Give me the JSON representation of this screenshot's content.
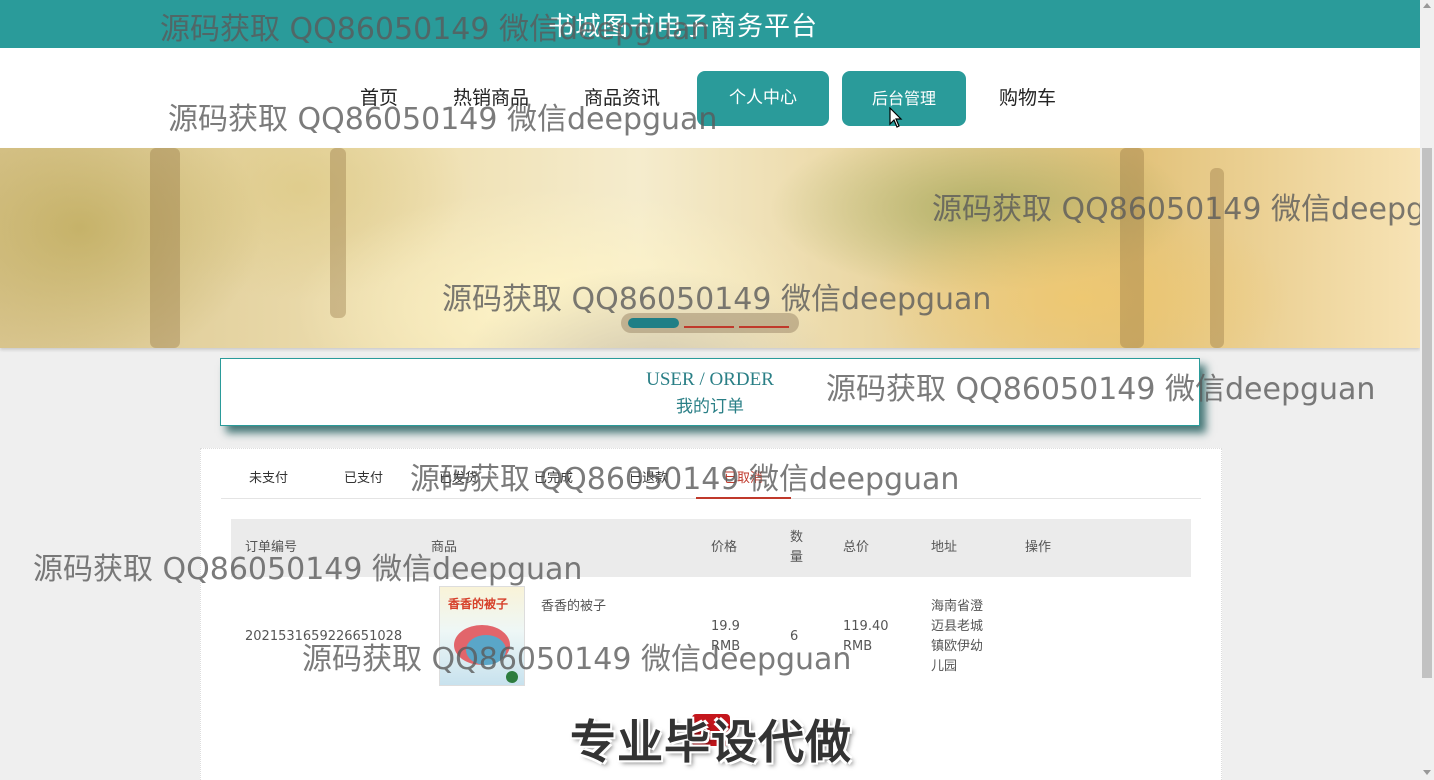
{
  "site": {
    "title": "书城图书电子商务平台"
  },
  "nav": {
    "items": [
      {
        "label": "首页",
        "style": "plain"
      },
      {
        "label": "热销商品",
        "style": "plain"
      },
      {
        "label": "商品资讯",
        "style": "plain"
      },
      {
        "label": "个人中心",
        "style": "button"
      },
      {
        "label": "后台管理",
        "style": "button"
      },
      {
        "label": "购物车",
        "style": "plain"
      }
    ]
  },
  "banner": {
    "slides_total": 3,
    "active_slide": 1
  },
  "order_header": {
    "en": "USER / ORDER",
    "cn": "我的订单"
  },
  "order_tabs": {
    "items": [
      "未支付",
      "已支付",
      "已发货",
      "已完成",
      "已退款",
      "已取消"
    ],
    "active": "已取消"
  },
  "order_table": {
    "headers": {
      "order_no": "订单编号",
      "product": "商品",
      "price": "价格",
      "quantity": "数量",
      "total": "总价",
      "address": "地址",
      "action": "操作"
    },
    "rows": [
      {
        "order_no": "2021531659226651028",
        "product_name": "香香的被子",
        "cover_title": "香香的被子",
        "price": "19.9 RMB",
        "quantity": "6",
        "total": "119.40 RMB",
        "address": "海南省澄迈县老城镇欧伊幼儿园"
      }
    ]
  },
  "promo": {
    "text": "专业毕设代做"
  },
  "watermark": {
    "text_a": "源码获取 QQ86050149 微信deepguan",
    "text_b": "源码获取 QQ86050149 微信deepgua"
  },
  "colors": {
    "primary": "#2a9b9a",
    "active_tab": "#c0392b",
    "page_bg": "#efefef"
  }
}
